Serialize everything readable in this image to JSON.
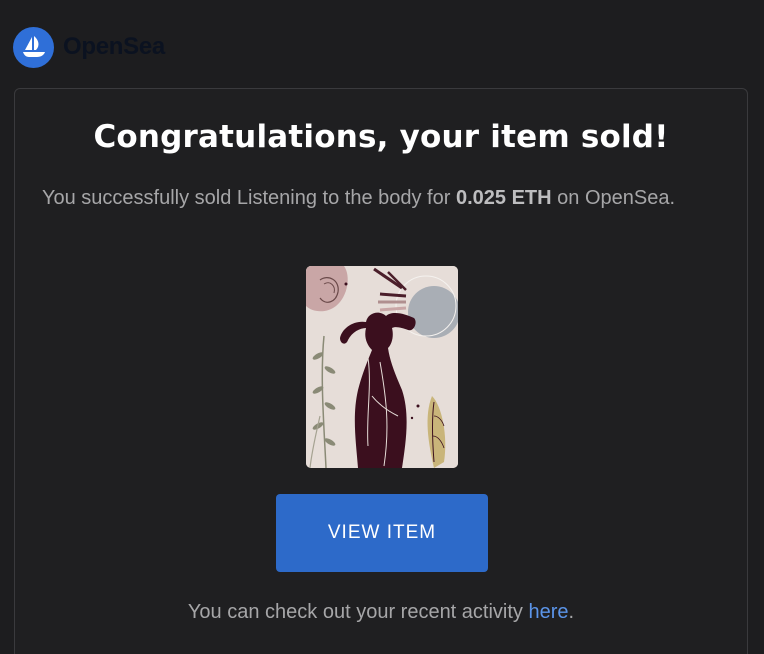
{
  "header": {
    "brand": "OpenSea",
    "logo_icon": "sailboat-icon",
    "logo_color": "#2f6fd8"
  },
  "card": {
    "title": "Congratulations, your item sold!",
    "message_before": "You successfully sold Listening to the body for ",
    "price": "0.025 ETH",
    "message_after": " on OpenSea.",
    "nft_image_icon": "nft-artwork-image",
    "view_button_label": "VIEW ITEM",
    "view_button_color": "#2d6ac9",
    "footer_before": "You can check out your recent activity ",
    "footer_link": "here",
    "footer_after": "."
  }
}
